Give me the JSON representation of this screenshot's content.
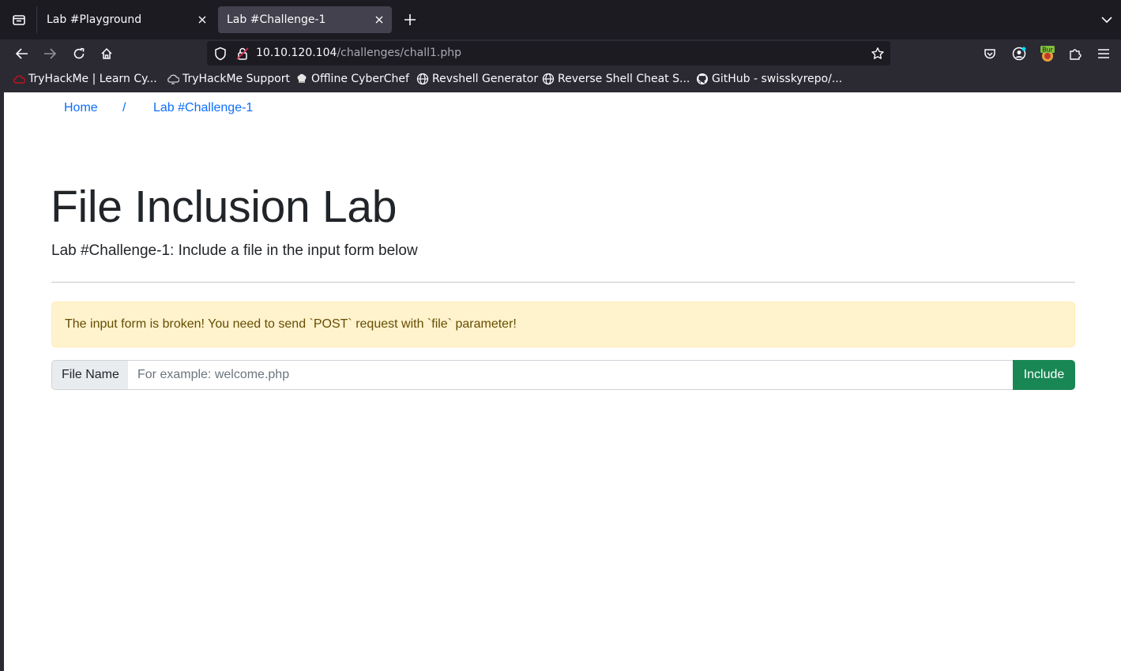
{
  "tabs": [
    {
      "title": "Lab #Playground",
      "active": false
    },
    {
      "title": "Lab #Challenge-1",
      "active": true
    }
  ],
  "navbar": {
    "url_host": "10.10.120.104",
    "url_path": "/challenges/chall1.php",
    "extension_badge": "Bur"
  },
  "bookmarks": [
    {
      "label": "TryHackMe | Learn Cy...",
      "icon": "tryhackme-cloud-icon"
    },
    {
      "label": "TryHackMe Support",
      "icon": "support-cloud-icon"
    },
    {
      "label": "Offline CyberChef",
      "icon": "chef-hat-icon"
    },
    {
      "label": "Revshell Generator",
      "icon": "globe-icon"
    },
    {
      "label": "Reverse Shell Cheat S...",
      "icon": "globe-icon"
    },
    {
      "label": "GitHub - swisskyrepo/...",
      "icon": "github-icon"
    }
  ],
  "breadcrumb": {
    "home": "Home",
    "separator": "/",
    "current": "Lab #Challenge-1"
  },
  "page": {
    "title": "File Inclusion Lab",
    "lead": "Lab #Challenge-1: Include a file in the input form below",
    "alert": "The input form is broken! You need to send `POST` request with `file` parameter!"
  },
  "form": {
    "label": "File Name",
    "value": "",
    "placeholder": "For example: welcome.php",
    "button": "Include"
  },
  "colors": {
    "link": "#0d6efd",
    "alert_bg": "#fff3cd",
    "alert_text": "#664d03",
    "button": "#198754",
    "browser_dark": "#1c1b22"
  }
}
